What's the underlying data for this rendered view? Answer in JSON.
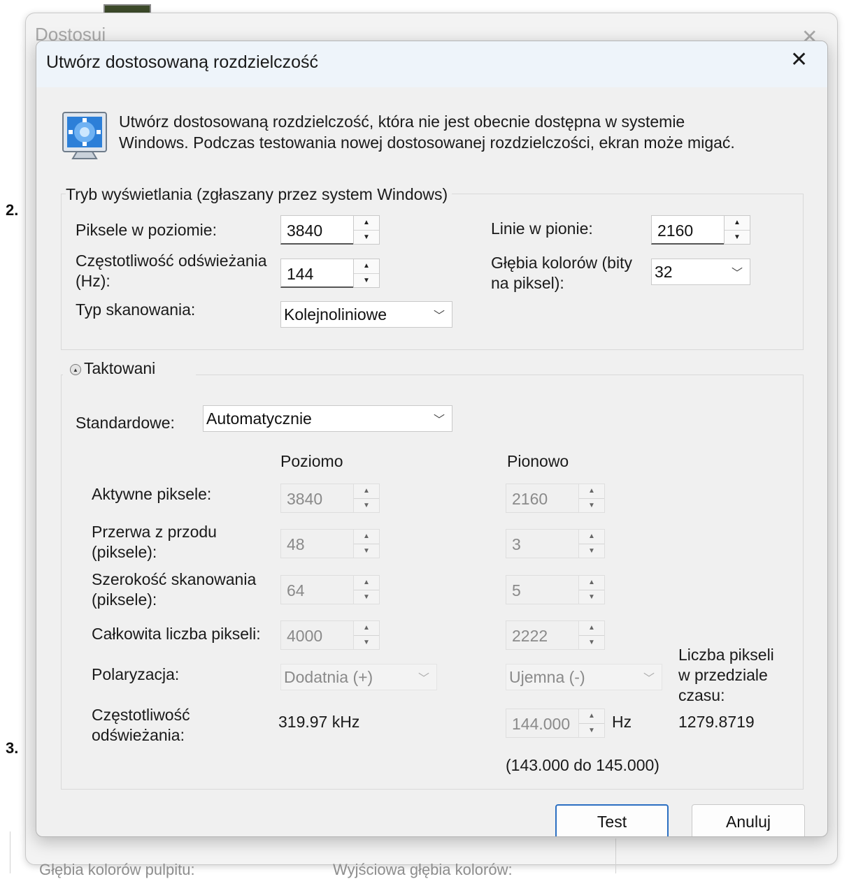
{
  "background": {
    "window_title": "Dostosuj",
    "step_2": "2.",
    "step_3": "3.",
    "bottom_left_label": "Głębia kolorów pulpitu:",
    "bottom_right_label": "Wyjściowa głębia kolorów:"
  },
  "dialog": {
    "title": "Utwórz dostosowaną rozdzielczość",
    "intro_line1": "Utwórz dostosowaną rozdzielczość, która nie jest obecnie dostępna w systemie",
    "intro_line2": "Windows. Podczas testowania nowej dostosowanej rozdzielczości, ekran może migać."
  },
  "display_mode": {
    "group_label": "Tryb wyświetlania (zgłaszany przez system Windows)",
    "h_pixels_label": "Piksele w poziomie:",
    "h_pixels_value": "3840",
    "v_lines_label": "Linie w pionie:",
    "v_lines_value": "2160",
    "refresh_label_1": "Częstotliwość odświeżania",
    "refresh_label_2": "(Hz):",
    "refresh_value": "144",
    "color_depth_label_1": "Głębia kolorów (bity",
    "color_depth_label_2": "na piksel):",
    "color_depth_value": "32",
    "scan_type_label": "Typ skanowania:",
    "scan_type_value": "Kolejnoliniowe"
  },
  "timing": {
    "group_label": "Taktowani",
    "standard_label": "Standardowe:",
    "standard_value": "Automatycznie",
    "col_horizontal": "Poziomo",
    "col_vertical": "Pionowo",
    "rows": {
      "active_label": "Aktywne piksele:",
      "active_h": "3840",
      "active_v": "2160",
      "front_porch_label_1": "Przerwa z przodu",
      "front_porch_label_2": "(piksele):",
      "front_porch_h": "48",
      "front_porch_v": "3",
      "sync_width_label_1": "Szerokość skanowania",
      "sync_width_label_2": "(piksele):",
      "sync_width_h": "64",
      "sync_width_v": "5",
      "total_label": "Całkowita liczba pikseli:",
      "total_h": "4000",
      "total_v": "2222",
      "polarity_label": "Polaryzacja:",
      "polarity_h": "Dodatnia (+)",
      "polarity_v": "Ujemna (-)",
      "refresh_label_1": "Częstotliwość",
      "refresh_label_2": "odświeżania:",
      "refresh_h": "319.97 kHz",
      "refresh_v": "144.000",
      "refresh_unit": "Hz",
      "refresh_range": "(143.000 do 145.000)"
    },
    "pixel_clock_label_1": "Liczba pikseli",
    "pixel_clock_label_2": "w przedziale",
    "pixel_clock_label_3": "czasu:",
    "pixel_clock_value": "1279.8719"
  },
  "buttons": {
    "test": "Test",
    "cancel": "Anuluj"
  },
  "icons": {
    "spin_up": "▲",
    "spin_down": "▼",
    "dropdown": "﹀",
    "close": "✕",
    "collapse": "▲"
  }
}
